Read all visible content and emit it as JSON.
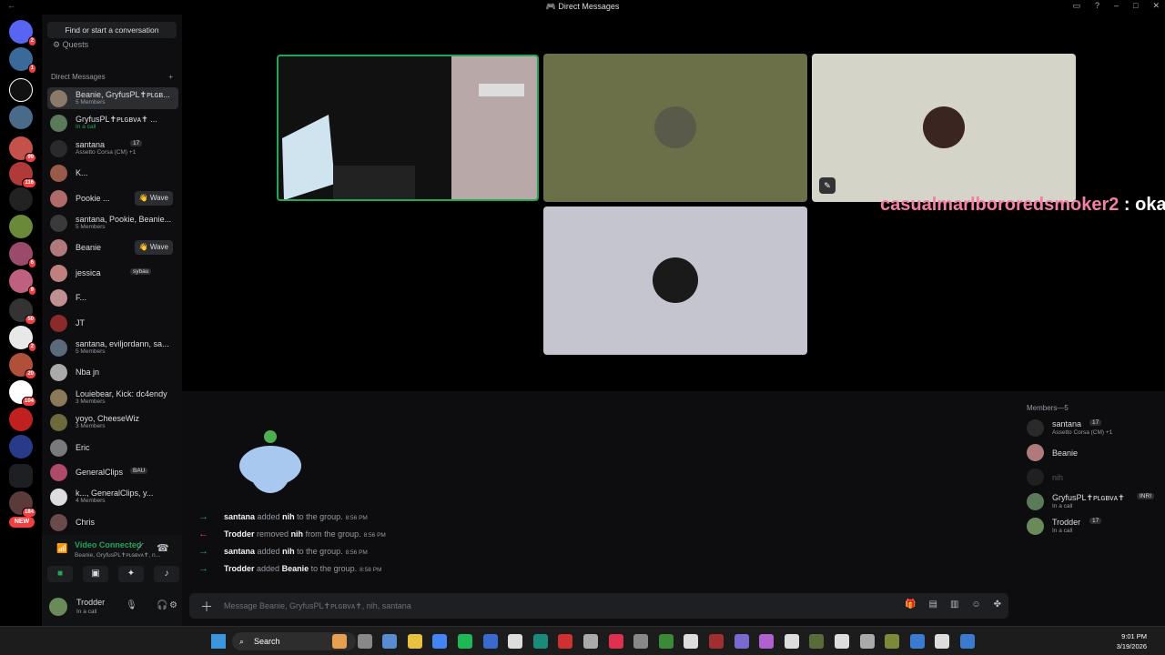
{
  "window": {
    "title": "Direct Messages"
  },
  "sidebar": {
    "search_label": "Find or start a conversation",
    "quests_label": "Quests",
    "dm_header": "Direct Messages",
    "add_dm": "+",
    "dms": [
      {
        "name": "Beanie, GryfusPL✝ᴘʟɢʙ...",
        "sub": "5 Members",
        "color": "#8a7a6a"
      },
      {
        "name": "GryfusPL✝ᴘʟɢʙᴠᴀ✝ ...",
        "sub": "In a call",
        "color": "#5a7a5a"
      },
      {
        "name": "santana",
        "tag": "17",
        "sub": "Assetto Corsa (CM) +1",
        "color": "#2a2a2a"
      },
      {
        "name": "K...",
        "sub": "",
        "color": "#9a5a4a"
      },
      {
        "name": "Pookie ...",
        "sub": "",
        "wave": "👋 Wave",
        "color": "#b06a6a"
      },
      {
        "name": "santana, Pookie, Beanie...",
        "sub": "5 Members",
        "color": "#3a3a3a"
      },
      {
        "name": "Beanie",
        "sub": "",
        "wave": "👋 Wave",
        "color": "#b07a7a"
      },
      {
        "name": "jessica",
        "tag": "sybau",
        "sub": "",
        "color": "#c08080"
      },
      {
        "name": "F...",
        "sub": "",
        "color": "#c09090"
      },
      {
        "name": "JT",
        "sub": "",
        "color": "#8a2a2a"
      },
      {
        "name": "santana, eviljordann, sa...",
        "sub": "5 Members",
        "color": "#5a6a7a"
      },
      {
        "name": "Nba jn",
        "sub": "",
        "color": "#aaaaaa"
      },
      {
        "name": "Louiebear, Kick: dc4endy",
        "sub": "3 Members",
        "color": "#8a7a5a"
      },
      {
        "name": "yoyo, CheeseWiz",
        "sub": "3 Members",
        "color": "#6a6a3a"
      },
      {
        "name": "Eric",
        "sub": "",
        "color": "#7a7a7a"
      },
      {
        "name": "GeneralClips",
        "tag": "BAU",
        "sub": "",
        "color": "#b04a6a"
      },
      {
        "name": "k..., GeneralClips, y...",
        "sub": "4 Members",
        "color": "#ddd"
      },
      {
        "name": "Chris",
        "sub": "",
        "color": "#6a4a4a"
      }
    ]
  },
  "rail": {
    "badges": [
      "2",
      "1",
      "99",
      "116",
      "6",
      "9",
      "50",
      "2",
      "20",
      "104",
      "184"
    ],
    "new_label": "NEW"
  },
  "voice": {
    "status": "Video Connected",
    "channel": "Beanie, GryfusPL✝ᴘʟɢʙᴠᴀ✝, n..."
  },
  "user": {
    "name": "Trodder",
    "status": "In a call"
  },
  "overlay": {
    "user": "casualmarlbororedsmoker2",
    "text": " : oka"
  },
  "messages": [
    {
      "dir": "in",
      "actor": "santana",
      "verb": "added",
      "target": "nih",
      "rest": "to the group.",
      "time": "8:56 PM"
    },
    {
      "dir": "out",
      "actor": "Trodder",
      "verb": "removed",
      "target": "nih",
      "rest": "from the group.",
      "time": "8:56 PM"
    },
    {
      "dir": "in",
      "actor": "santana",
      "verb": "added",
      "target": "nih",
      "rest": "to the group.",
      "time": "8:56 PM"
    },
    {
      "dir": "in",
      "actor": "Trodder",
      "verb": "added",
      "target": "Beanie",
      "rest": "to the group.",
      "time": "8:58 PM"
    }
  ],
  "composer": {
    "placeholder": "Message Beanie, GryfusPL✝ᴘʟɢʙᴠᴀ✝, nih, santana"
  },
  "members": {
    "header": "Members—5",
    "list": [
      {
        "name": "santana",
        "tag": "17",
        "sub": "Assetto Corsa (CM) +1",
        "color": "#2a2a2a"
      },
      {
        "name": "Beanie",
        "sub": "",
        "color": "#b07a7a"
      },
      {
        "name": "nih",
        "sub": "",
        "color": "#444",
        "dim": true
      },
      {
        "name": "GryfusPL✝ᴘʟɢʙᴠᴀ✝",
        "tag": "INRI",
        "sub": "In a call",
        "color": "#5a7a5a"
      },
      {
        "name": "Trodder",
        "tag": "17",
        "sub": "In a call",
        "color": "#6a8a5a"
      }
    ]
  },
  "taskbar": {
    "search_label": "Search",
    "time": "9:01 PM",
    "date": "3/19/2026"
  }
}
